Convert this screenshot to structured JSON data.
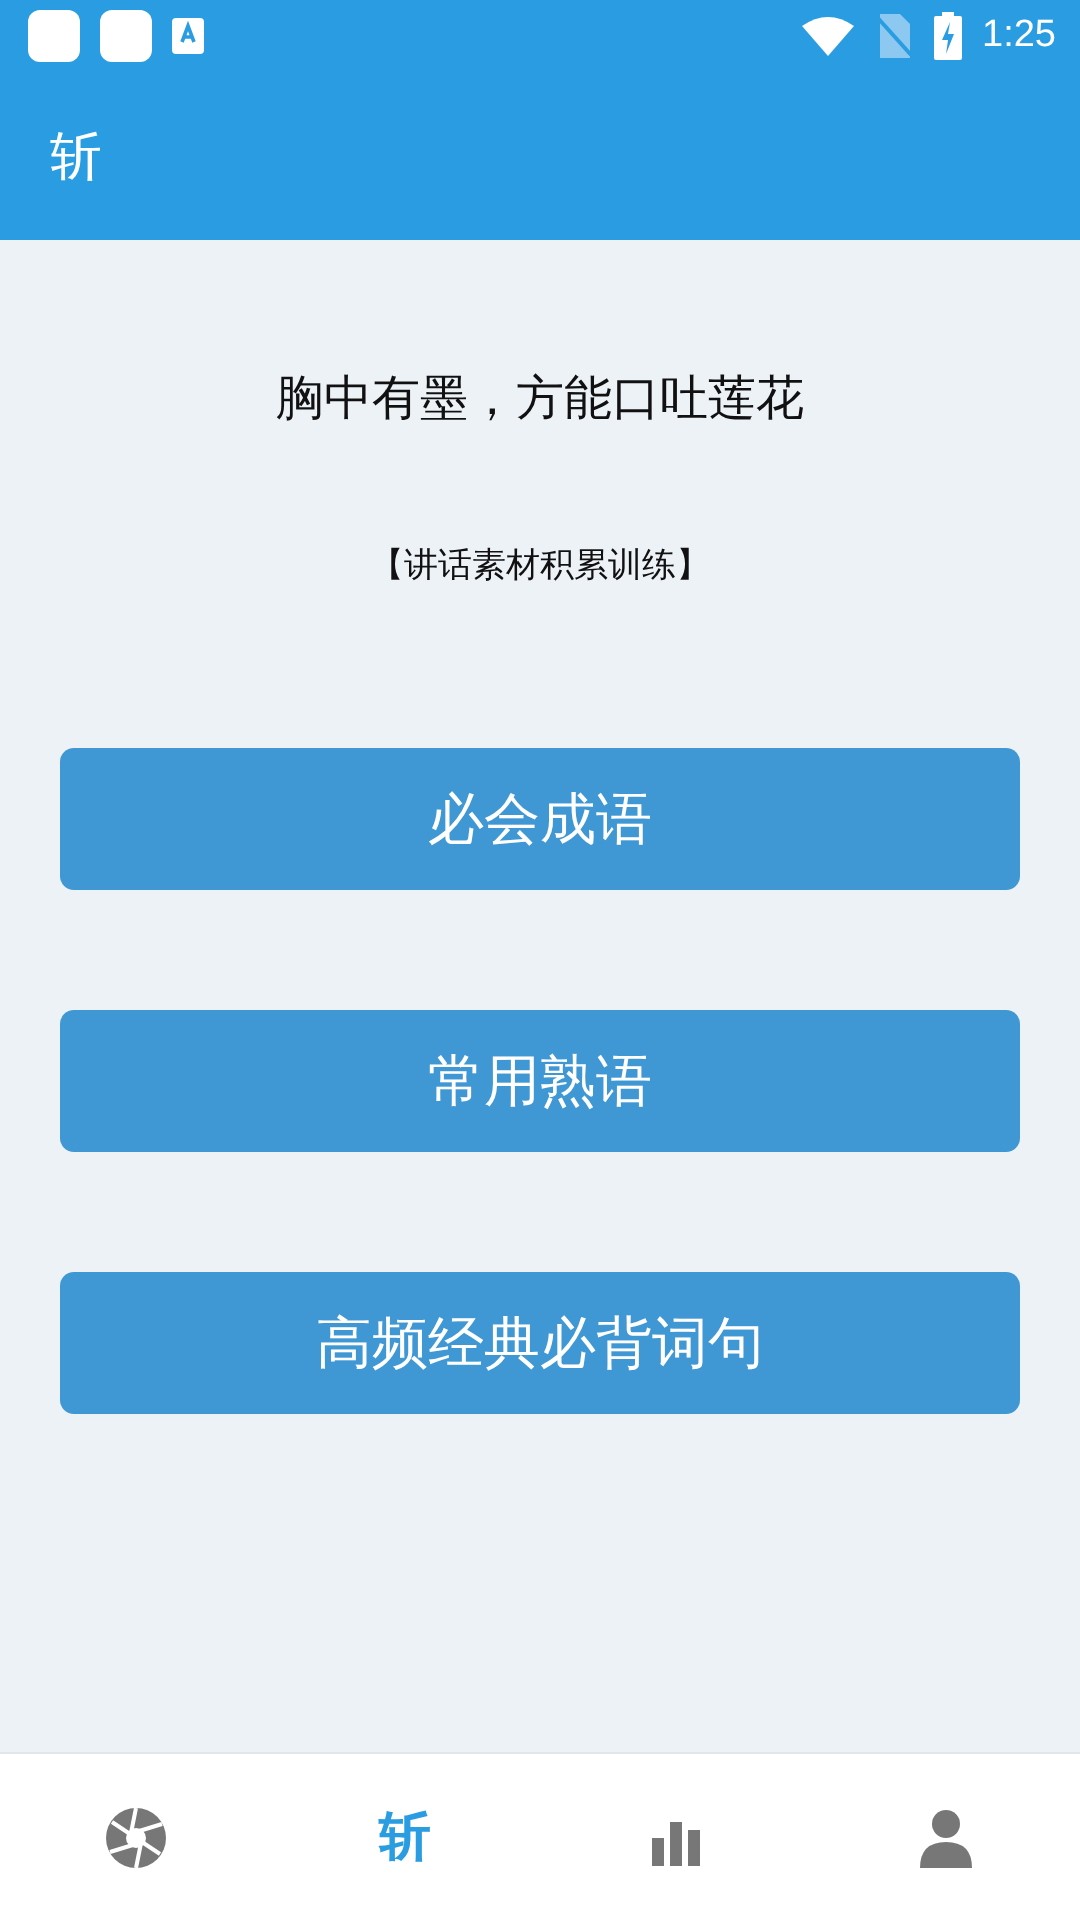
{
  "status_bar": {
    "time": "1:25"
  },
  "app_bar": {
    "title": "斩"
  },
  "headline": "胸中有墨，方能口吐莲花",
  "subtitle": "【讲话素材积累训练】",
  "buttons": [
    "必会成语",
    "常用熟语",
    "高频经典必背词句"
  ],
  "bottom_nav": [
    {
      "kind": "aperture",
      "selected": false
    },
    {
      "kind": "text",
      "label": "斩",
      "selected": true
    },
    {
      "kind": "chart",
      "selected": false
    },
    {
      "kind": "person",
      "selected": false
    }
  ]
}
